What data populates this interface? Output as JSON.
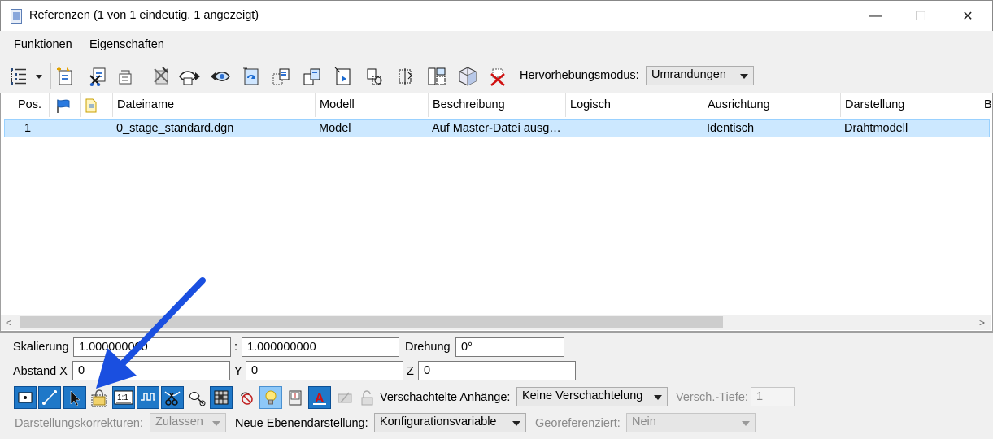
{
  "window": {
    "title": "Referenzen (1 von 1 eindeutig, 1 angezeigt)",
    "minimize_glyph": "—",
    "maximize_glyph": "☐",
    "close_glyph": "✕"
  },
  "menu": {
    "items": [
      {
        "label": "Funktionen"
      },
      {
        "label": "Eigenschaften"
      }
    ]
  },
  "toolbar": {
    "highlight_label": "Hervorhebungsmodus:",
    "highlight_value": "Umrandungen",
    "icons": [
      "tree-view-icon",
      "attach-reference-icon",
      "detach-reference-icon",
      "reload-reference-icon",
      "exchange-reference-icon",
      "move-reference-icon",
      "copy-reference-icon",
      "scale-reference-icon",
      "rotate-reference-icon",
      "mirror-horizontal-icon",
      "mirror-vertical-icon",
      "clip-boundary-icon",
      "clip-mask-icon",
      "delete-clip-icon",
      "clip-front-icon",
      "make-direct-attachment-icon",
      "delete-clip-red-icon"
    ]
  },
  "table": {
    "columns": [
      "Pos.",
      "",
      "",
      "Dateiname",
      "Modell",
      "Beschreibung",
      "Logisch",
      "Ausrichtung",
      "Darstellung",
      "B"
    ],
    "rows": [
      {
        "pos": "1",
        "dateiname": "0_stage_standard.dgn",
        "modell": "Model",
        "beschreibung": "Auf Master-Datei ausg…",
        "logisch": "",
        "ausrichtung": "Identisch",
        "darstellung": "Drahtmodell"
      }
    ]
  },
  "scrollbar": {
    "left_glyph": "<",
    "right_glyph": ">"
  },
  "properties": {
    "skalierung_label": "Skalierung",
    "skalierung_value_1": "1.000000000",
    "colon": ":",
    "skalierung_value_2": "1.000000000",
    "drehung_label": "Drehung",
    "drehung_value": "0°",
    "abstand_label": "Abstand X",
    "abstand_x_value": "0",
    "y_label": "Y",
    "y_value": "0",
    "z_label": "Z",
    "z_value": "0",
    "verschachtelte_label": "Verschachtelte Anhänge:",
    "verschachtelte_value": "Keine Verschachtelung",
    "versch_tiefe_label": "Versch.-Tiefe:",
    "versch_tiefe_value": "1",
    "darstellungskorrekturen_label": "Darstellungskorrekturen:",
    "darstellungskorrekturen_value": "Zulassen",
    "neue_ebenendarstellung_label": "Neue Ebenendarstellung:",
    "neue_ebenendarstellung_value": "Konfigurationsvariable",
    "georeferenziert_label": "Georeferenziert:",
    "georeferenziert_value": "Nein",
    "icon_toolbar": [
      "display-toggle-icon",
      "snap-toggle-icon",
      "locate-toggle-icon",
      "lock-icon",
      "true-scale-icon",
      "ignore-attachment-icon",
      "treat-as-element-icon",
      "scale-line-styles-icon",
      "raster-icon",
      "no-display-overrides-icon",
      "lights-icon",
      "georeference-book-icon",
      "text-annotation-icon",
      "print-disabled-icon",
      "unlock-disabled-icon"
    ]
  },
  "annotation": {
    "arrow_color": "#1a4fe0"
  }
}
